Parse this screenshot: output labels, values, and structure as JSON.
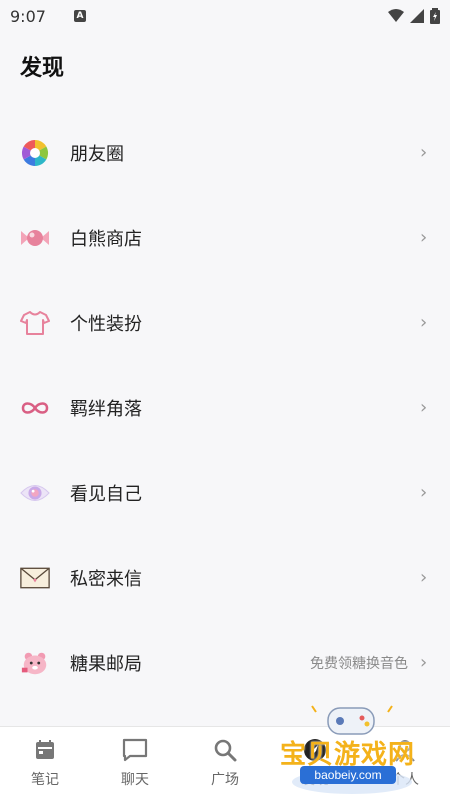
{
  "status": {
    "time": "9:07",
    "indicator": "A"
  },
  "header": {
    "title": "发现"
  },
  "menu": [
    {
      "id": "moments",
      "label": "朋友圈",
      "icon": "aperture-icon"
    },
    {
      "id": "shop",
      "label": "白熊商店",
      "icon": "candy-icon"
    },
    {
      "id": "outfit",
      "label": "个性装扮",
      "icon": "tshirt-icon"
    },
    {
      "id": "bond",
      "label": "羁绊角落",
      "icon": "infinity-icon"
    },
    {
      "id": "self",
      "label": "看见自己",
      "icon": "eye-icon"
    },
    {
      "id": "letters",
      "label": "私密来信",
      "icon": "envelope-icon"
    },
    {
      "id": "post",
      "label": "糖果邮局",
      "icon": "bear-icon",
      "hint": "免费领糖换音色"
    }
  ],
  "nav": [
    {
      "label": "笔记",
      "icon": "calendar-icon"
    },
    {
      "label": "聊天",
      "icon": "chat-bubble-icon"
    },
    {
      "label": "广场",
      "icon": "search-icon"
    },
    {
      "label": "发现",
      "icon": "discover-icon",
      "active": true
    },
    {
      "label": "个人",
      "icon": "person-icon"
    }
  ],
  "watermark": {
    "text": "宝贝游戏网",
    "url": "baobeiy.com"
  },
  "colors": {
    "background": "#f7f7f9",
    "nav_bg": "#ffffff",
    "accent": "#e7829c"
  }
}
